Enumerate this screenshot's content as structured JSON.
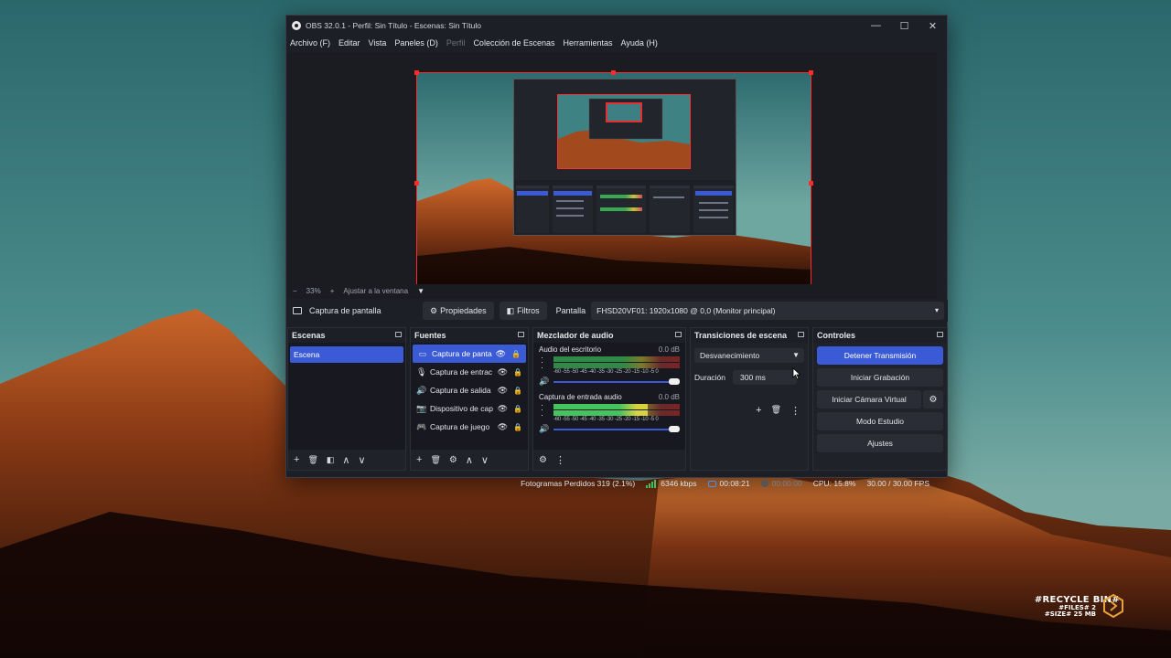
{
  "window": {
    "title": "OBS 32.0.1 - Perfil: Sin Título - Escenas: Sin Título",
    "minimize": "—",
    "maximize": "☐",
    "close": "✕"
  },
  "menu": [
    {
      "label": "Archivo (F)",
      "enabled": true
    },
    {
      "label": "Editar",
      "enabled": true
    },
    {
      "label": "Vista",
      "enabled": true
    },
    {
      "label": "Paneles (D)",
      "enabled": true
    },
    {
      "label": "Perfil",
      "enabled": false
    },
    {
      "label": "Colección de Escenas",
      "enabled": true
    },
    {
      "label": "Herramientas",
      "enabled": true
    },
    {
      "label": "Ayuda (H)",
      "enabled": true
    }
  ],
  "zoom": {
    "minus": "−",
    "value": "33%",
    "plus": "+",
    "fit": "Ajustar a la ventana",
    "caret": "▼"
  },
  "source_toolbar": {
    "source_name": "Captura de pantalla",
    "properties": "Propiedades",
    "filters": "Filtros",
    "display_label": "Pantalla",
    "display_value": "FHSD20VF01: 1920x1080 @ 0,0 (Monitor principal)",
    "caret": "▾"
  },
  "scenes": {
    "title": "Escenas",
    "items": [
      "Escena"
    ],
    "footer_icons": [
      "+",
      "🗑",
      "◧",
      "∧",
      "∨"
    ]
  },
  "sources": {
    "title": "Fuentes",
    "items": [
      {
        "icon": "▭",
        "label": "Captura de panta",
        "selected": true
      },
      {
        "icon": "🎙",
        "label": "Captura de entrac",
        "selected": false
      },
      {
        "icon": "🔊",
        "label": "Captura de salida",
        "selected": false
      },
      {
        "icon": "📷",
        "label": "Dispositivo de cap",
        "selected": false
      },
      {
        "icon": "🎮",
        "label": "Captura de juego",
        "selected": false
      }
    ],
    "eye": "👁",
    "lock": "🔒",
    "footer_icons": [
      "+",
      "🗑",
      "⚙",
      "∧",
      "∨"
    ]
  },
  "mixer": {
    "title": "Mezclador de audio",
    "ticks": "-60 -55 -50 -45 -40 -35 -30 -25 -20 -15 -10 -5  0",
    "channels": [
      {
        "name": "Audio del escritorio",
        "db": "0.0 dB",
        "level": 0
      },
      {
        "name": "Captura de entrada audio",
        "db": "0.0 dB",
        "level": 0.78
      }
    ],
    "footer_icons": [
      "⚙",
      "⋮"
    ]
  },
  "transitions": {
    "title": "Transiciones de escena",
    "selected": "Desvanecimiento",
    "duration_label": "Duración",
    "duration_value": "300 ms",
    "tools": [
      "+",
      "🗑",
      "⋮"
    ]
  },
  "controls": {
    "title": "Controles",
    "stop_stream": "Detener Transmisión",
    "start_recording": "Iniciar Grabación",
    "start_virtual_cam": "Iniciar Cámara Virtual",
    "studio_mode": "Modo Estudio",
    "settings": "Ajustes",
    "gear": "⚙"
  },
  "status": {
    "dropped_frames": "Fotogramas Perdidos 319 (2.1%)",
    "bitrate": "6346 kbps",
    "stream_time": "00:08:21",
    "rec_time": "00:00:00",
    "cpu": "CPU: 15.8%",
    "fps": "30.00 / 30.00 FPS"
  },
  "desktop": {
    "recycle_title": "#RECYCLE BIN#",
    "recycle_files": "#FILES# 2",
    "recycle_size": "#SIZE# 25 MB"
  },
  "colors": {
    "accent": "#3b5bd6",
    "selection_border": "#ff2b2b",
    "window_bg": "#1d1f26"
  }
}
